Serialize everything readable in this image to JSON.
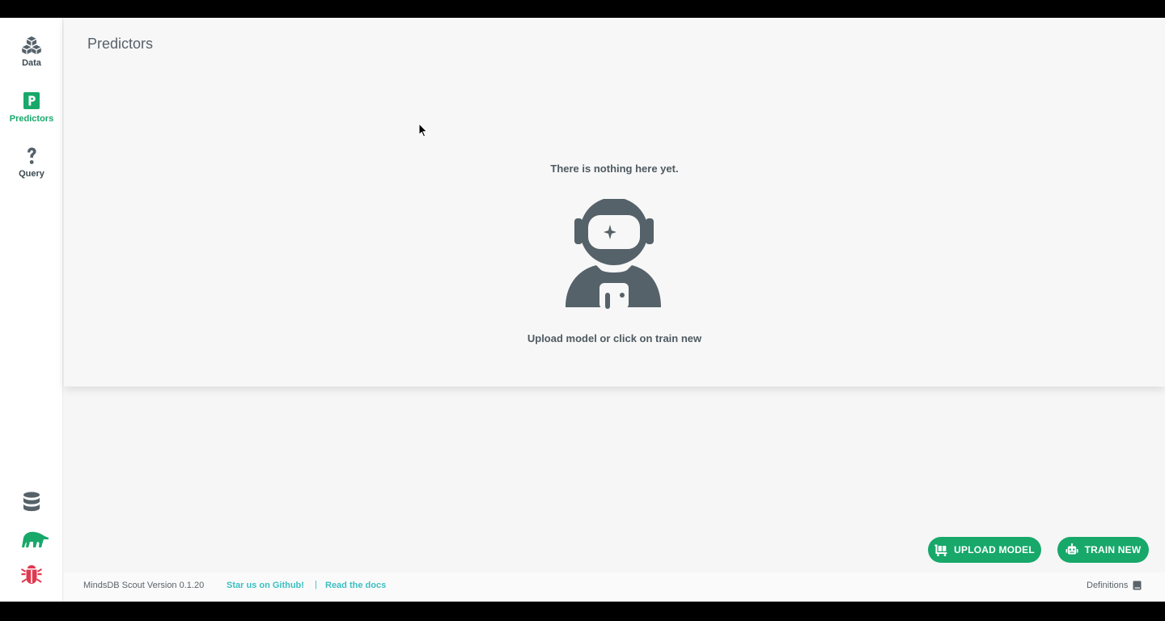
{
  "sidebar": {
    "items": [
      {
        "label": "Data",
        "icon": "cubes-icon"
      },
      {
        "label": "Predictors",
        "icon": "predictor-p-icon"
      },
      {
        "label": "Query",
        "icon": "question-icon"
      }
    ],
    "bottom_icons": [
      "database-icon",
      "anteater-logo-icon",
      "bug-icon"
    ]
  },
  "main": {
    "title": "Predictors",
    "empty_title": "There is nothing here yet.",
    "empty_subtitle": "Upload model or click on train new"
  },
  "actions": {
    "upload_label": "UPLOAD MODEL",
    "train_label": "TRAIN NEW"
  },
  "footer": {
    "version": "MindsDB Scout Version 0.1.20",
    "github": "Star us on Github!",
    "separator": "|",
    "docs": "Read the docs",
    "definitions": "Definitions"
  },
  "colors": {
    "accent": "#17a86a",
    "link": "#3bbfc2",
    "icon": "#56626a",
    "bug": "#e0394f"
  }
}
